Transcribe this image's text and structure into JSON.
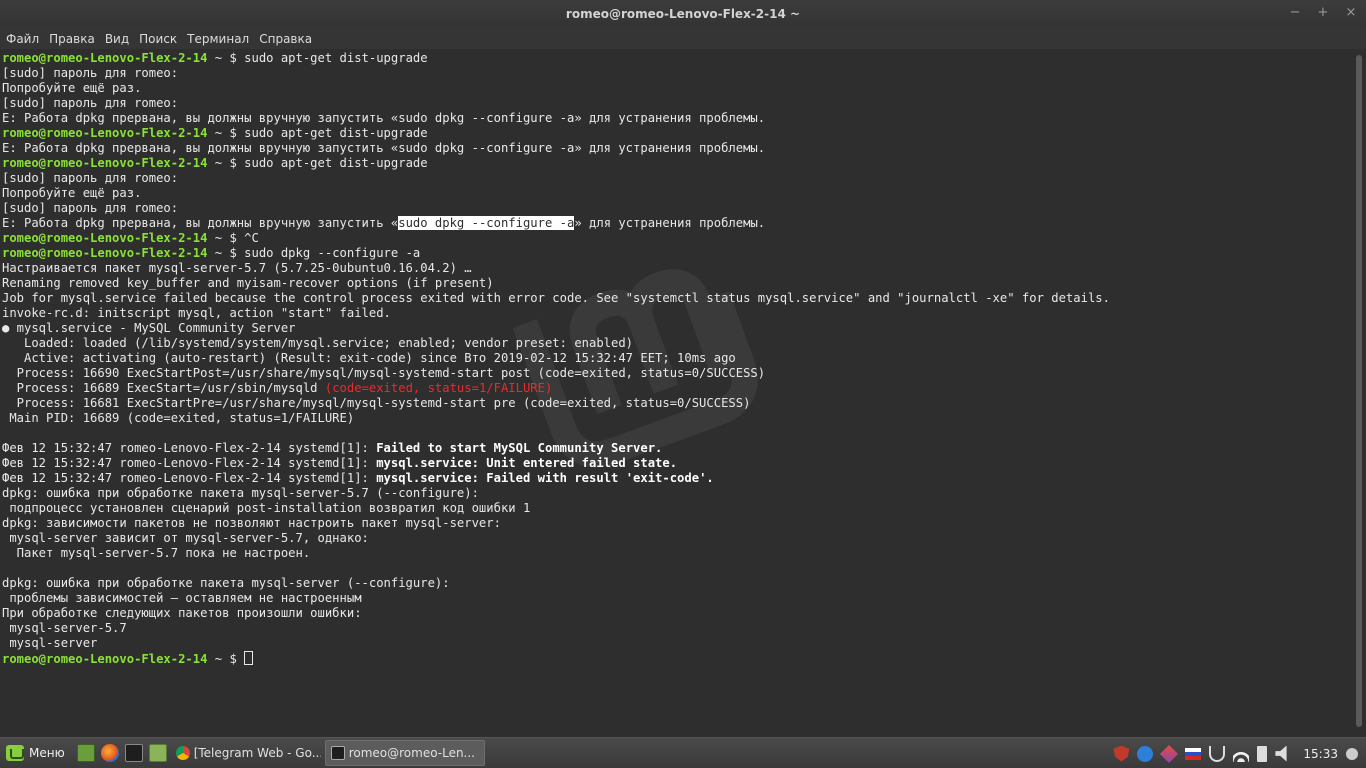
{
  "window": {
    "title": "romeo@romeo-Lenovo-Flex-2-14 ~",
    "controls": {
      "minimize": "−",
      "maximize": "+",
      "close": "×"
    }
  },
  "menubar": [
    "Файл",
    "Правка",
    "Вид",
    "Поиск",
    "Терминал",
    "Справка"
  ],
  "terminal": {
    "prompt": "romeo@romeo-Lenovo-Flex-2-14",
    "prompt_tail": " ~ $ ",
    "lines": {
      "l1_cmd": "sudo apt-get dist-upgrade",
      "l2": "[sudo] пароль для romeo:",
      "l3": "Попробуйте ещё раз.",
      "l4": "[sudo] пароль для romeo:",
      "l5": "E: Работа dpkg прервана, вы должны вручную запустить «sudo dpkg --configure -a» для устранения проблемы.",
      "l6_cmd": "sudo apt-get dist-upgrade",
      "l7": "E: Работа dpkg прервана, вы должны вручную запустить «sudo dpkg --configure -a» для устранения проблемы.",
      "l8_cmd": "sudo apt-get dist-upgrade",
      "l9": "[sudo] пароль для romeo:",
      "l10": "Попробуйте ещё раз.",
      "l11": "[sudo] пароль для romeo:",
      "l12_pre": "E: Работа dpkg прервана, вы должны вручную запустить «",
      "l12_sel": "sudo dpkg --configure -a",
      "l12_post": "» для устранения проблемы.",
      "l13_cmd": "^C",
      "l14_cmd": "sudo dpkg --configure -a",
      "l15": "Настраивается пакет mysql-server-5.7 (5.7.25-0ubuntu0.16.04.2) …",
      "l16": "Renaming removed key_buffer and myisam-recover options (if present)",
      "l17": "Job for mysql.service failed because the control process exited with error code. See \"systemctl status mysql.service\" and \"journalctl -xe\" for details.",
      "l18": "invoke-rc.d: initscript mysql, action \"start\" failed.",
      "l19": "● mysql.service - MySQL Community Server",
      "l20": "   Loaded: loaded (/lib/systemd/system/mysql.service; enabled; vendor preset: enabled)",
      "l21": "   Active: activating (auto-restart) (Result: exit-code) since Вто 2019-02-12 15:32:47 EET; 10ms ago",
      "l22": "  Process: 16690 ExecStartPost=/usr/share/mysql/mysql-systemd-start post (code=exited, status=0/SUCCESS)",
      "l23_pre": "  Process: 16689 ExecStart=/usr/sbin/mysqld ",
      "l23_red": "(code=exited, status=1/FAILURE)",
      "l24": "  Process: 16681 ExecStartPre=/usr/share/mysql/mysql-systemd-start pre (code=exited, status=0/SUCCESS)",
      "l25": " Main PID: 16689 (code=exited, status=1/FAILURE)",
      "l27_pre": "Фев 12 15:32:47 romeo-Lenovo-Flex-2-14 systemd[1]: ",
      "l27_red": "Failed to start MySQL Community Server.",
      "l28_pre": "Фев 12 15:32:47 romeo-Lenovo-Flex-2-14 systemd[1]: ",
      "l28_bold": "mysql.service: Unit entered failed state.",
      "l29_pre": "Фев 12 15:32:47 romeo-Lenovo-Flex-2-14 systemd[1]: ",
      "l29_bold": "mysql.service: Failed with result 'exit-code'.",
      "l30": "dpkg: ошибка при обработке пакета mysql-server-5.7 (--configure):",
      "l31": " подпроцесс установлен сценарий post-installation возвратил код ошибки 1",
      "l32": "dpkg: зависимости пакетов не позволяют настроить пакет mysql-server:",
      "l33": " mysql-server зависит от mysql-server-5.7, однако:",
      "l34": "  Пакет mysql-server-5.7 пока не настроен.",
      "l36": "dpkg: ошибка при обработке пакета mysql-server (--configure):",
      "l37": " проблемы зависимостей — оставляем не настроенным",
      "l38": "При обработке следующих пакетов произошли ошибки:",
      "l39": " mysql-server-5.7",
      "l40": " mysql-server"
    }
  },
  "taskbar": {
    "menu_label": "Меню",
    "tasks": [
      {
        "label": "[Telegram Web - Go...",
        "active": false
      },
      {
        "label": "romeo@romeo-Len...",
        "active": true
      }
    ],
    "clock": "15:33"
  },
  "colors": {
    "prompt": "#8ae234",
    "error": "#ef2929",
    "terminal_bg": "#2e2e2e",
    "text": "#e8e8e8"
  }
}
